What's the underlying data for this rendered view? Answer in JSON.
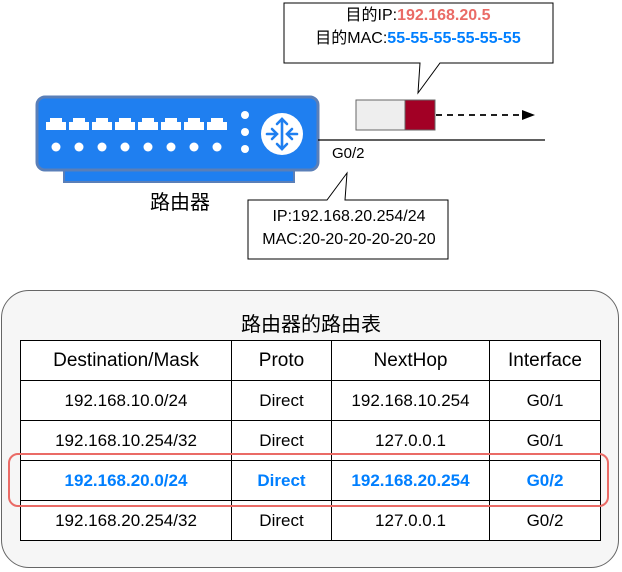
{
  "router": {
    "label": "路由器"
  },
  "port": {
    "label": "G0/2"
  },
  "destination_callout": {
    "ip_label": "目的IP:",
    "ip_value": "192.168.20.5",
    "mac_label": "目的MAC:",
    "mac_value": "55-55-55-55-55-55"
  },
  "port_callout": {
    "ip_line": "IP:192.168.20.254/24",
    "mac_line": "MAC:20-20-20-20-20-20"
  },
  "route_table": {
    "title": "路由器的路由表",
    "columns": [
      "Destination/Mask",
      "Proto",
      "NextHop",
      "Interface"
    ],
    "rows": [
      [
        "192.168.10.0/24",
        "Direct",
        "192.168.10.254",
        "G0/1"
      ],
      [
        "192.168.10.254/32",
        "Direct",
        "127.0.0.1",
        "G0/1"
      ],
      [
        "192.168.20.0/24",
        "Direct",
        "192.168.20.254",
        "G0/2"
      ],
      [
        "192.168.20.254/32",
        "Direct",
        "127.0.0.1",
        "G0/2"
      ]
    ],
    "highlighted_row": 2
  },
  "colors": {
    "router_blue": "#1f7ff0",
    "router_border": "#5a7fb8",
    "highlight_red": "#ea6b66",
    "highlight_blue": "#007fff",
    "packet_header": "#a20025"
  }
}
